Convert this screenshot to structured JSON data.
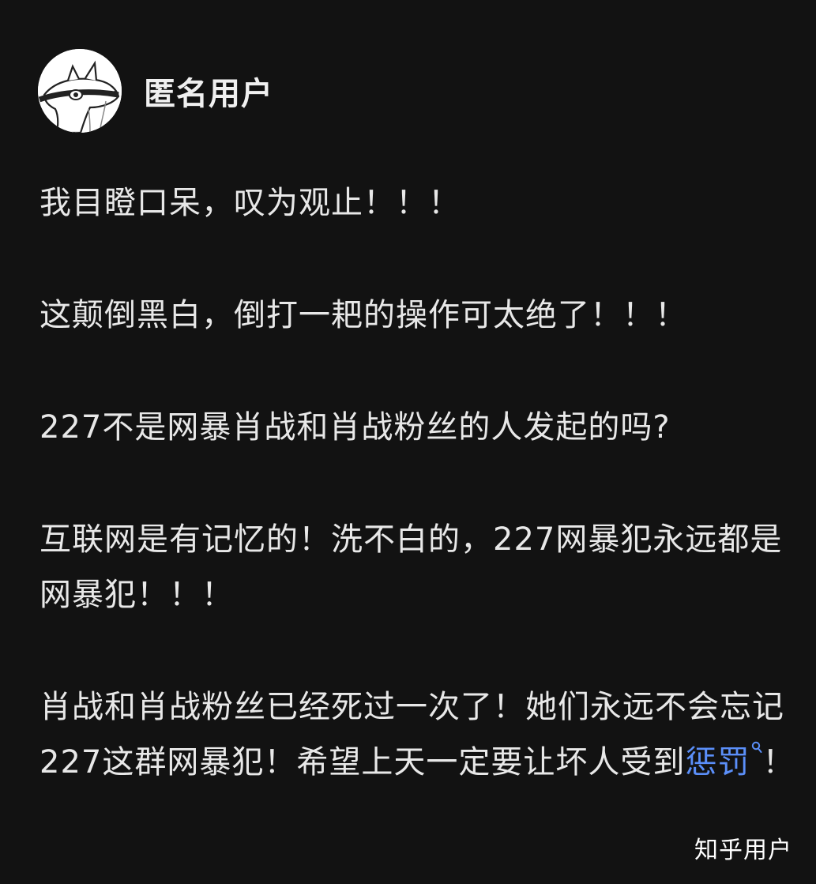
{
  "author": {
    "name": "匿名用户",
    "avatar_icon": "anonymous-fish-cat-avatar"
  },
  "paragraphs": [
    "我目瞪口呆，叹为观止！！！",
    "这颠倒黑白，倒打一耙的操作可太绝了！！！",
    "227不是网暴肖战和肖战粉丝的人发起的吗?",
    "互联网是有记忆的！洗不白的，227网暴犯永远都是网暴犯！！！"
  ],
  "last_paragraph": {
    "text_before_link": "肖战和肖战粉丝已经死过一次了！她们永远不会忘记227这群网暴犯！希望上天一定要让坏人受到",
    "link_text": "惩罚",
    "link_icon": "search-icon",
    "text_after_link": "！"
  },
  "watermark": "知乎用户",
  "colors": {
    "background": "#121212",
    "text": "#e8e8e8",
    "link": "#5b8ff9"
  }
}
